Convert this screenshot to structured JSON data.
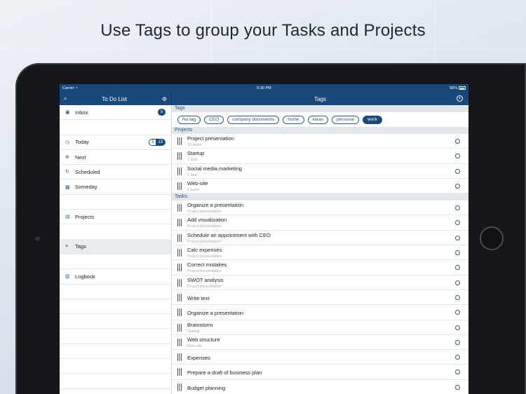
{
  "headline": "Use Tags to group your Tasks and Projects",
  "status": {
    "carrier": "Carrier",
    "time": "5:30 PM",
    "battery": "95%"
  },
  "sidebar": {
    "title": "To Do List",
    "items": [
      {
        "label": "Inbox",
        "icon": "inbox-icon",
        "badge": "5"
      },
      {
        "label": "Today",
        "icon": "clock-icon",
        "badge_a": "3",
        "badge_b": "13"
      },
      {
        "label": "Next",
        "icon": "next-icon"
      },
      {
        "label": "Scheduled",
        "icon": "repeat-icon"
      },
      {
        "label": "Someday",
        "icon": "calendar-icon"
      },
      {
        "label": "Projects",
        "icon": "projects-icon"
      },
      {
        "label": "Tags",
        "icon": "tag-icon"
      },
      {
        "label": "Logbook",
        "icon": "logbook-icon"
      }
    ]
  },
  "main": {
    "title": "Tags",
    "tags_header": "Tags",
    "tags": [
      "No tag",
      "CEO",
      "company documents",
      "home",
      "ideas",
      "personal",
      "work"
    ],
    "active_tag": "work",
    "projects_header": "Projects",
    "projects": [
      {
        "name": "Project presentation",
        "sub": "10 tasks"
      },
      {
        "name": "Startup",
        "sub": "1 task"
      },
      {
        "name": "Social media marketing",
        "sub": "1 task"
      },
      {
        "name": "Web-site",
        "sub": "2 tasks"
      }
    ],
    "tasks_header": "Tasks",
    "tasks": [
      {
        "name": "Organize a presentation",
        "sub": "Project presentation"
      },
      {
        "name": "Add visualization",
        "sub": "Project presentation"
      },
      {
        "name": "Schedule an appointment with CEO",
        "sub": "Project presentation"
      },
      {
        "name": "Calc expenses",
        "sub": "Project presentation"
      },
      {
        "name": "Correct mistakes",
        "sub": "Project presentation"
      },
      {
        "name": "SWOT analysis",
        "sub": "Project presentation"
      },
      {
        "name": "Write text",
        "sub": ""
      },
      {
        "name": "Organize a presentation",
        "sub": ""
      },
      {
        "name": "Brainstorm",
        "sub": "Startup"
      },
      {
        "name": "Web structure",
        "sub": "Web-site"
      },
      {
        "name": "Expenses",
        "sub": ""
      },
      {
        "name": "Prepare a draft of business plan",
        "sub": ""
      },
      {
        "name": "Budget planning",
        "sub": ""
      }
    ]
  },
  "colors": {
    "brand": "#17497c",
    "accent": "#2a5d94",
    "section_bg": "#e3e7ec"
  }
}
